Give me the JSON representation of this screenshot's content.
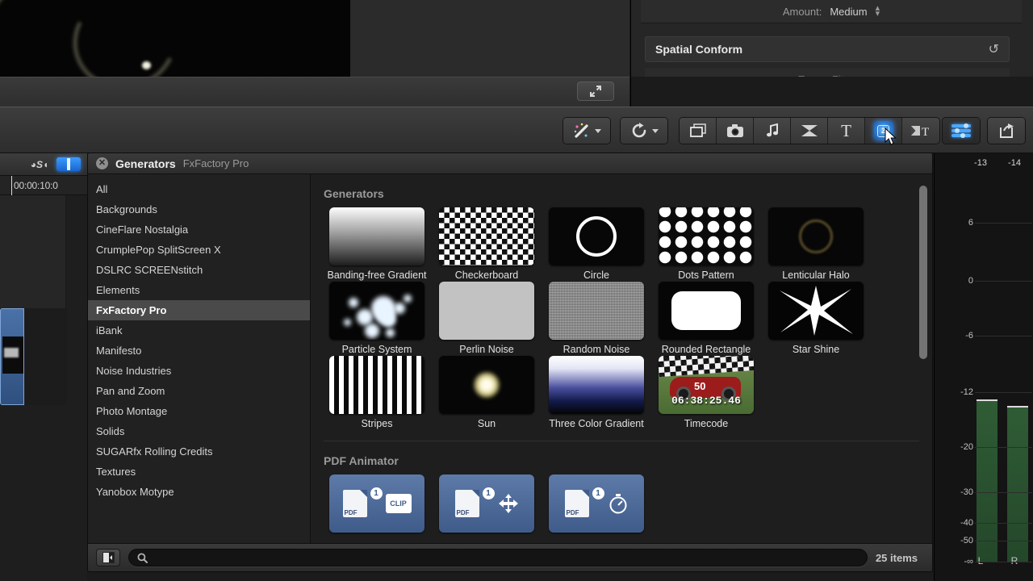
{
  "inspector": {
    "amount_label": "Amount:",
    "amount_value": "Medium",
    "section_title": "Spatial Conform",
    "type_label": "Type:",
    "type_value": "Fit"
  },
  "toolbar": {
    "buttons": [
      {
        "name": "enhancements",
        "icon": "magic-wand-icon",
        "has_caret": true
      },
      {
        "name": "retime",
        "icon": "retime-icon",
        "has_caret": true
      },
      {
        "name": "media-browser",
        "icon": "media-stack-icon",
        "has_caret": false
      },
      {
        "name": "photos",
        "icon": "camera-icon",
        "has_caret": false
      },
      {
        "name": "music",
        "icon": "music-note-icon",
        "has_caret": false
      },
      {
        "name": "transitions",
        "icon": "transition-icon",
        "has_caret": false
      },
      {
        "name": "titles",
        "icon": "title-T-icon",
        "has_caret": false
      },
      {
        "name": "generators",
        "icon": "generators-icon",
        "has_caret": false,
        "active": true
      },
      {
        "name": "themes",
        "icon": "themes-icon",
        "has_caret": false
      },
      {
        "name": "timeline-index",
        "icon": "index-sliders-icon",
        "has_caret": false,
        "on": true
      },
      {
        "name": "share",
        "icon": "share-arrow-icon",
        "has_caret": false
      }
    ],
    "expand_icon": "expand-arrows-icon"
  },
  "browser": {
    "close_icon": "close-icon",
    "title": "Generators",
    "subtitle": "FxFactory Pro",
    "sidebar_items": [
      {
        "label": "All",
        "selected": false
      },
      {
        "label": "Backgrounds",
        "selected": false
      },
      {
        "label": "CineFlare Nostalgia",
        "selected": false
      },
      {
        "label": "CrumplePop SplitScreen X",
        "selected": false
      },
      {
        "label": "DSLRC SCREENstitch",
        "selected": false
      },
      {
        "label": "Elements",
        "selected": false
      },
      {
        "label": "FxFactory Pro",
        "selected": true
      },
      {
        "label": "iBank",
        "selected": false
      },
      {
        "label": "Manifesto",
        "selected": false
      },
      {
        "label": "Noise Industries",
        "selected": false
      },
      {
        "label": "Pan and Zoom",
        "selected": false
      },
      {
        "label": "Photo Montage",
        "selected": false
      },
      {
        "label": "Solids",
        "selected": false
      },
      {
        "label": "SUGARfx Rolling Credits",
        "selected": false
      },
      {
        "label": "Textures",
        "selected": false
      },
      {
        "label": "Yanobox Motype",
        "selected": false
      }
    ],
    "sections": [
      {
        "label": "Generators",
        "items": [
          {
            "label": "Banding-free Gradient",
            "thumb": "banding"
          },
          {
            "label": "Checkerboard",
            "thumb": "checker"
          },
          {
            "label": "Circle",
            "thumb": "circle"
          },
          {
            "label": "Dots Pattern",
            "thumb": "dots"
          },
          {
            "label": "Lenticular Halo",
            "thumb": "halo"
          },
          {
            "label": "Particle System",
            "thumb": "particle"
          },
          {
            "label": "Perlin Noise",
            "thumb": "perlin"
          },
          {
            "label": "Random Noise",
            "thumb": "random"
          },
          {
            "label": "Rounded Rectangle",
            "thumb": "rounded"
          },
          {
            "label": "Star Shine",
            "thumb": "star"
          },
          {
            "label": "Stripes",
            "thumb": "stripes"
          },
          {
            "label": "Sun",
            "thumb": "sun"
          },
          {
            "label": "Three Color Gradient",
            "thumb": "three"
          },
          {
            "label": "Timecode",
            "thumb": "timecode",
            "overlay_text": "06:38:25.46",
            "car_number": "50"
          }
        ]
      },
      {
        "label": "PDF Animator",
        "items": [
          {
            "label": "",
            "thumb": "pdf",
            "tag": "CLIP"
          },
          {
            "label": "",
            "thumb": "pdf",
            "tag": "move"
          },
          {
            "label": "",
            "thumb": "pdf",
            "tag": "timer"
          }
        ]
      }
    ],
    "search_placeholder": "",
    "search_value": "",
    "search_icon": "search-icon",
    "sidebar_toggle_icon": "sidebar-toggle-icon",
    "item_count": "25 items"
  },
  "timeline": {
    "solo_icon": "solo-icon",
    "snapping_icon": "snapping-icon",
    "timecode": "00:00:10:0"
  },
  "meters": {
    "left_readout": "-13",
    "right_readout": "-14",
    "ticks": [
      "6",
      "0",
      "-6",
      "-12",
      "-20",
      "-30",
      "-40",
      "-50",
      "-∞"
    ],
    "left_label": "L",
    "right_label": "R",
    "left_level": "-13",
    "right_level": "-14"
  }
}
